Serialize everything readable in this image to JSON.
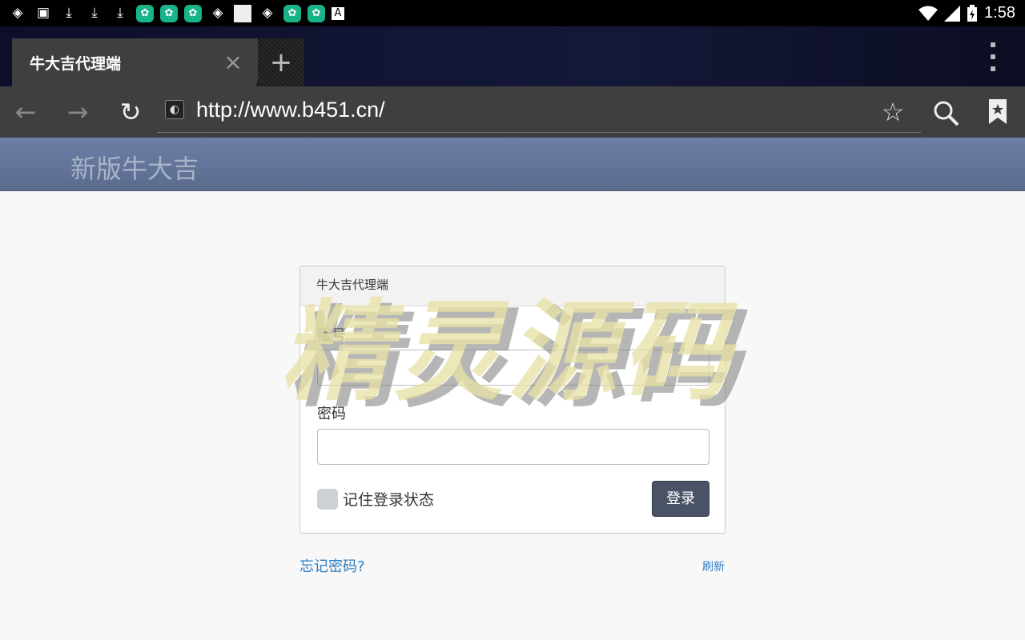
{
  "status_bar": {
    "time": "1:58",
    "notification_icons": [
      "aperture-icon",
      "image-icon",
      "download-icon",
      "download-icon",
      "download-icon",
      "app-icon",
      "app-icon",
      "app-icon",
      "aperture-icon",
      "blank-icon",
      "aperture-icon",
      "app-icon",
      "app-icon",
      "font-icon"
    ],
    "system_icons": [
      "wifi-icon",
      "cell-signal-icon",
      "battery-charging-icon"
    ]
  },
  "browser": {
    "tab_title": "牛大吉代理端",
    "url": "http://www.b451.cn/",
    "new_tab": "+",
    "close": "×"
  },
  "page": {
    "brand": "新版牛大吉",
    "panel_title": "牛大吉代理端",
    "account_label": "账号",
    "password_label": "密码",
    "remember_label": "记住登录状态",
    "login_button": "登录",
    "forgot_link": "忘记密码?",
    "refresh_link": "刷新"
  },
  "watermark": {
    "text": "精灵源码"
  },
  "colors": {
    "tab_bg": "#3f3f3f",
    "header_bg": "#6d7fa6",
    "button_bg": "#4a5366",
    "link": "#2c7ec3"
  }
}
